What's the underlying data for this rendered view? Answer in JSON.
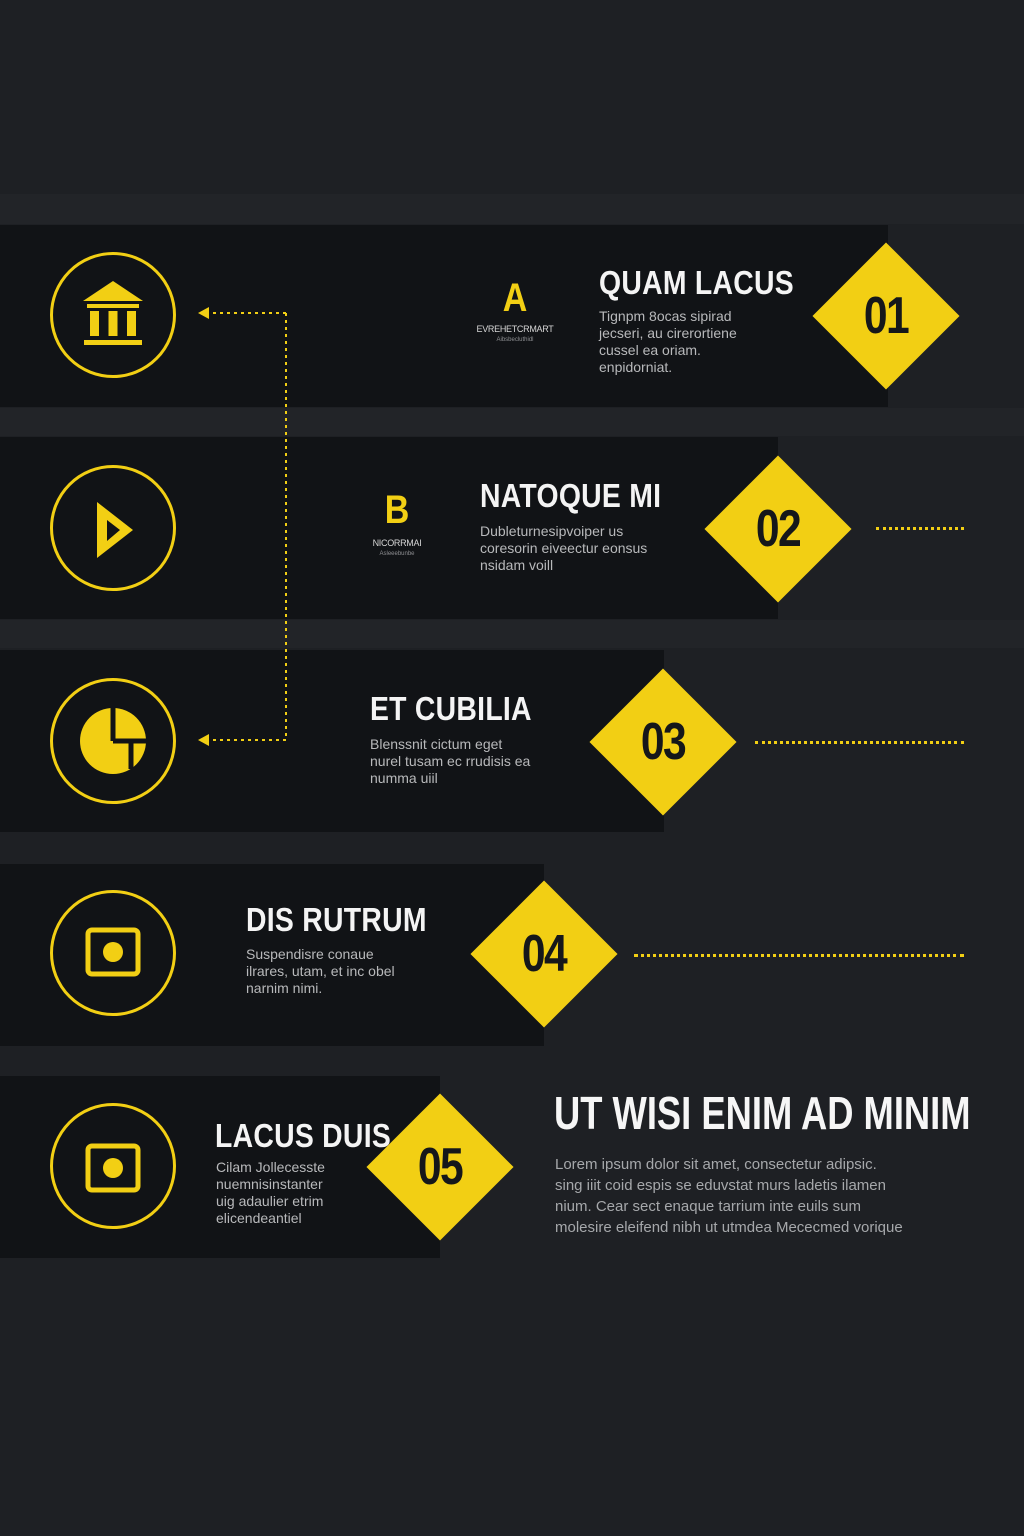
{
  "colors": {
    "background": "#1e2024",
    "panel": "#111316",
    "accent": "#f2cf14",
    "text": "#f4f4f4",
    "muted_text": "#b8b9bb"
  },
  "steps": [
    {
      "number": "01",
      "title": "QUAM LACUS",
      "description": [
        "Tignpm 8ocas sipirad",
        "jecseri, au cirerortiene",
        "cussel ea oriam.",
        "enpidorniat."
      ],
      "icon": "bank-icon",
      "mark": {
        "letter": "A",
        "caption": "EVREHETCRMART",
        "sub": "Aibsbecluthidl"
      }
    },
    {
      "number": "02",
      "title": "NATOQUE MI",
      "description": [
        "Dubleturnesipvoiper us",
        "coresorin eiveectur eonsus",
        "nsidam voill"
      ],
      "icon": "play-icon",
      "mark": {
        "letter": "B",
        "caption": "NICORRMAI",
        "sub": "Asleeebunbe"
      }
    },
    {
      "number": "03",
      "title": "ET CUBILIA",
      "description": [
        "Blenssnit cictum eget",
        "nurel tusam ec rrudisis ea",
        "numma uiil"
      ],
      "icon": "pie-chart-icon"
    },
    {
      "number": "04",
      "title": "DIS RUTRUM",
      "description": [
        "Suspendisre conaue",
        "ilrares, utam, et inc obel",
        "narnim nimi."
      ],
      "icon": "target-square-icon"
    },
    {
      "number": "05",
      "title": "LACUS DUIS",
      "description": [
        "Cilam Jollecesste",
        "nuemnisinstanter",
        "uig adaulier etrim",
        "elicendeantiel"
      ],
      "icon": "target-square-icon"
    }
  ],
  "summary": {
    "heading": "UT WISI ENIM AD MINIM",
    "body": [
      "Lorem ipsum dolor sit amet, consectetur adipsic.",
      "sing iiit coid espis se eduvstat murs ladetis ilamen",
      "nium. Cear sect enaque tarrium inte euils sum",
      "molesire eleifend nibh ut utmdea Mececmed vorique"
    ]
  }
}
